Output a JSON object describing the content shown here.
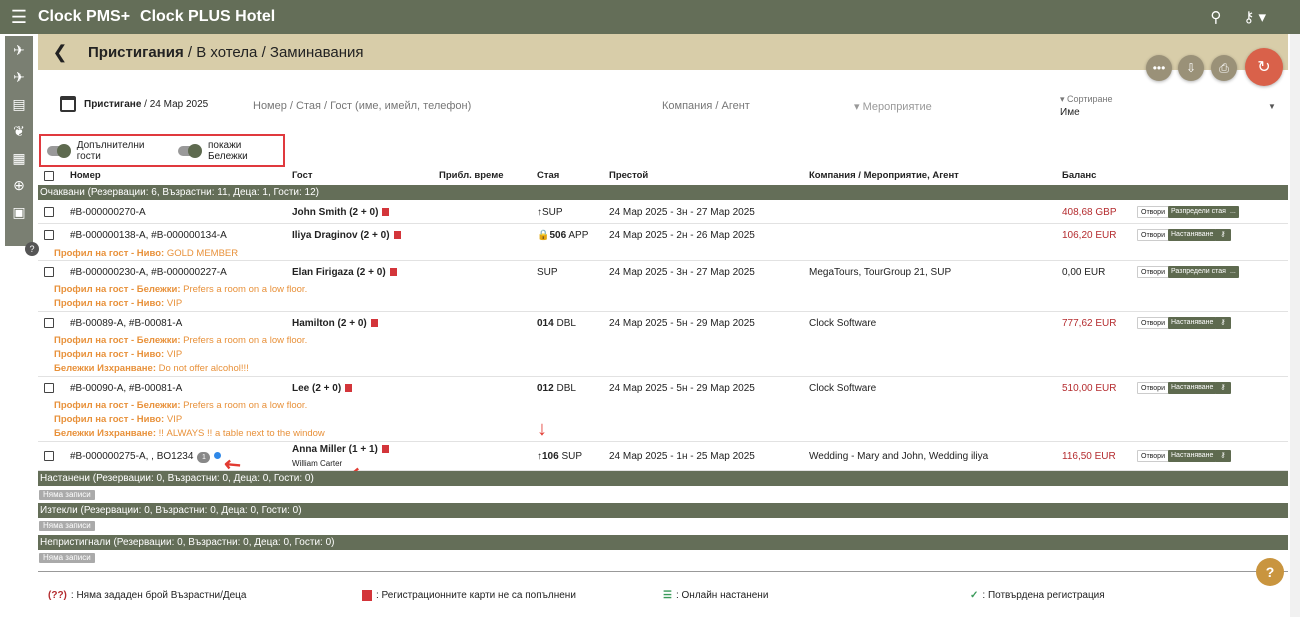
{
  "app": {
    "brand": "Clock PMS+",
    "hotel": "Clock PLUS Hotel"
  },
  "breadcrumb": {
    "current": "Пристигания",
    "sep1": "/",
    "item2": "В хотела",
    "sep2": "/",
    "item3": "Заминавания"
  },
  "filters": {
    "date_label": "Пристигане",
    "date_value": "/ 24 Мар 2025",
    "search_placeholder": "Номер / Стая / Гост (име, имейл, телефон)",
    "company_placeholder": "Компания / Агент",
    "event_placeholder": "Мероприятие",
    "sort_label": "Сортиране",
    "sort_value": "Име"
  },
  "toggles": {
    "extra_guests": "Допълнителни гости",
    "show_notes": "покажи Бележки"
  },
  "columns": {
    "number": "Номер",
    "guest": "Гост",
    "eta": "Прибл. време",
    "room": "Стая",
    "stay": "Престой",
    "company": "Компания / Мероприятие, Агент",
    "balance": "Баланс"
  },
  "groups": {
    "expected": "Очаквани (Резервации: 6, Възрастни: 11, Деца: 1, Гости: 12)",
    "checked_in": "Настанени (Резервации: 0, Възрастни: 0, Деца: 0, Гости: 0)",
    "checked_out": "Изтекли (Резервации: 0, Възрастни: 0, Деца: 0, Гости: 0)",
    "no_show": "Непристигнали (Резервации: 0, Възрастни: 0, Деца: 0, Гости: 0)",
    "no_records": "Няма записи"
  },
  "rows": [
    {
      "number": "#B-000000270-A",
      "guest": "John Smith (2 + 0)",
      "room": "SUP",
      "room_bold": "",
      "stay": "24 Мар 2025 - 3н - 27 Мар 2025",
      "company": "",
      "balance": "408,68 GBP",
      "btn1": "Отвори",
      "btn2": "Разпредели стая",
      "btn3": "...",
      "notes": []
    },
    {
      "number": "#B-000000138-A, #B-000000134-A",
      "guest": "Iliya Draginov (2 + 0)",
      "room": " APP",
      "room_bold": "506",
      "stay": "24 Мар 2025 - 2н - 26 Мар 2025",
      "company": "",
      "balance": "106,20 EUR",
      "btn1": "Отвори",
      "btn2": "Настаняване",
      "notes": [
        {
          "label": "Профил на гост - Ниво:",
          "text": " GOLD MEMBER"
        }
      ]
    },
    {
      "number": "#B-000000230-A, #B-000000227-A",
      "guest": "Elan Firigaza (2 + 0)",
      "room": "SUP",
      "room_bold": "",
      "stay": "24 Мар 2025 - 3н - 27 Мар 2025",
      "company": "MegaTours, TourGroup 21, SUP",
      "balance": "0,00 EUR",
      "btn1": "Отвори",
      "btn2": "Разпредели стая",
      "btn3": "...",
      "notes": [
        {
          "label": "Профил на гост - Бележки:",
          "text": " Prefers a room on a low floor."
        },
        {
          "label": "Профил на гост - Ниво:",
          "text": " VIP"
        }
      ]
    },
    {
      "number": "#B-00089-A, #B-00081-A",
      "guest": "Hamilton (2 + 0)",
      "room": " DBL",
      "room_bold": "014",
      "stay": "24 Мар 2025 - 5н - 29 Мар 2025",
      "company": "Clock Software",
      "balance": "777,62 EUR",
      "btn1": "Отвори",
      "btn2": "Настаняване",
      "notes": [
        {
          "label": "Профил на гост - Бележки:",
          "text": " Prefers a room on a low floor."
        },
        {
          "label": "Профил на гост - Ниво:",
          "text": " VIP"
        },
        {
          "label": "Бележки Изхранване:",
          "text": " Do not offer alcohol!!!"
        }
      ]
    },
    {
      "number": "#B-00090-A, #B-00081-A",
      "guest": "Lee (2 + 0)",
      "room": " DBL",
      "room_bold": "012",
      "stay": "24 Мар 2025 - 5н - 29 Мар 2025",
      "company": "Clock Software",
      "balance": "510,00 EUR",
      "btn1": "Отвори",
      "btn2": "Настаняване",
      "notes": [
        {
          "label": "Профил на гост - Бележки:",
          "text": " Prefers a room on a low floor."
        },
        {
          "label": "Профил на гост - Ниво:",
          "text": " VIP"
        },
        {
          "label": "Бележки Изхранване:",
          "text": " !! ALWAYS !! a table next to the window"
        }
      ]
    },
    {
      "number": "#B-000000275-A, , BO1234",
      "badge": "1",
      "guest": "Anna Miller (1 + 1)",
      "sub_guest": "William Carter",
      "room": " SUP",
      "room_bold": "106",
      "stay": "24 Мар 2025 - 1н - 25 Мар 2025",
      "company": "Wedding - Mary and John, Wedding iliya",
      "balance": "116,50 EUR",
      "btn1": "Отвори",
      "btn2": "Настаняване",
      "notes": []
    }
  ],
  "legend": {
    "unknown_marker": "(??)",
    "unknown_text": ": Няма зададен брой Възрастни/Деца",
    "reg_cards": ": Регистрационните карти не са попълнени",
    "online": ": Онлайн настанени",
    "confirmed": ": Потвърдена регистрация"
  },
  "colors": {
    "topbar": "#646e58",
    "breadcrumb_bg": "#d8cda9",
    "highlight_border": "#e0393e",
    "note_orange": "#e8913a",
    "balance_red": "#b42b2e"
  }
}
